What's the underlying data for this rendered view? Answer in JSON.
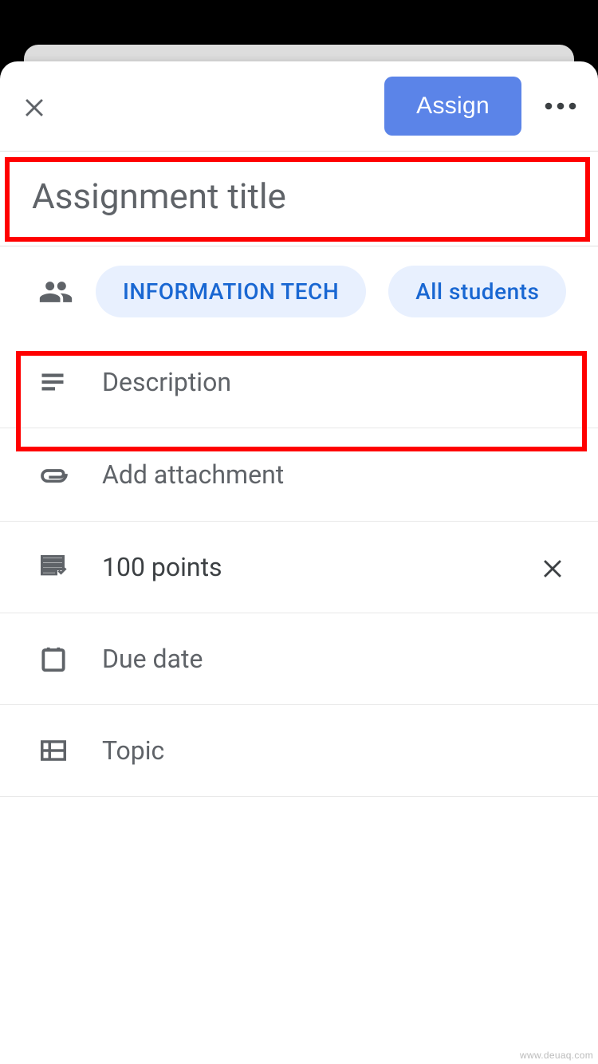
{
  "header": {
    "assign_label": "Assign"
  },
  "title": {
    "placeholder": "Assignment title",
    "value": ""
  },
  "audience": {
    "class_chip": "INFORMATION TECH",
    "students_chip": "All students"
  },
  "description": {
    "placeholder": "Description"
  },
  "attachment": {
    "label": "Add attachment"
  },
  "points": {
    "label": "100 points"
  },
  "due": {
    "label": "Due date"
  },
  "topic": {
    "label": "Topic"
  },
  "watermark": "www.deuaq.com"
}
